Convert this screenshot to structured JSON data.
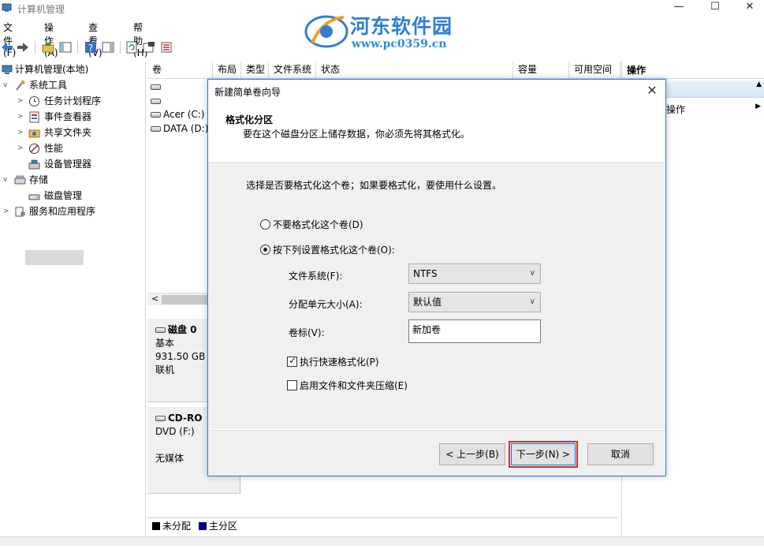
{
  "window": {
    "title": "计算机管理",
    "controls": {
      "minimize": "—",
      "maximize": "☐",
      "close": "✕"
    }
  },
  "watermark": {
    "name": "河东软件园",
    "url": "www.pc0359.cn"
  },
  "menu": [
    "文件(F)",
    "操作(A)",
    "查看(V)",
    "帮助(H)"
  ],
  "tree": {
    "root": "计算机管理(本地)",
    "items": [
      {
        "label": "系统工具",
        "icon": "tools-icon"
      },
      {
        "label": "任务计划程序",
        "icon": "clock-icon"
      },
      {
        "label": "事件查看器",
        "icon": "event-viewer-icon"
      },
      {
        "label": "共享文件夹",
        "icon": "shared-folder-icon"
      },
      {
        "label": "性能",
        "icon": "performance-icon"
      },
      {
        "label": "设备管理器",
        "icon": "device-manager-icon"
      },
      {
        "label": "存储",
        "icon": "storage-icon"
      },
      {
        "label": "磁盘管理",
        "icon": "disk-management-icon"
      },
      {
        "label": "服务和应用程序",
        "icon": "services-icon"
      }
    ]
  },
  "volume_list": {
    "columns": [
      "卷",
      "布局",
      "类型",
      "文件系统",
      "状态",
      "容量",
      "可用空间"
    ],
    "rows": [
      "",
      "",
      "Acer (C:)",
      "DATA (D:)"
    ]
  },
  "disks": [
    {
      "name": "磁盘 0",
      "type": "基本",
      "size": "931.50 GB",
      "status": "联机"
    },
    {
      "name": "CD-RO",
      "type": "DVD (F:)",
      "status": "无媒体"
    }
  ],
  "legend": [
    {
      "label": "未分配",
      "color": "#000000"
    },
    {
      "label": "主分区",
      "color": "#000080"
    }
  ],
  "actions": {
    "header": "操作",
    "item": "操作"
  },
  "dialog": {
    "title": "新建简单卷向导",
    "heading": "格式化分区",
    "subheading": "要在这个磁盘分区上储存数据，你必须先将其格式化。",
    "prompt": "选择是否要格式化这个卷；如果要格式化，要使用什么设置。",
    "option_no_format": "不要格式化这个卷(D)",
    "option_format": "按下列设置格式化这个卷(O):",
    "selected_option": "format",
    "filesystem_label": "文件系统(F):",
    "filesystem_value": "NTFS",
    "alloc_label": "分配单元大小(A):",
    "alloc_value": "默认值",
    "volume_label_label": "卷标(V):",
    "volume_label_value": "新加卷",
    "quick_format_label": "执行快速格式化(P)",
    "quick_format_checked": true,
    "compression_label": "启用文件和文件夹压缩(E)",
    "compression_checked": false,
    "back_button": "< 上一步(B)",
    "next_button": "下一步(N) >",
    "cancel_button": "取消",
    "highlight_color": "#e02a2a"
  }
}
